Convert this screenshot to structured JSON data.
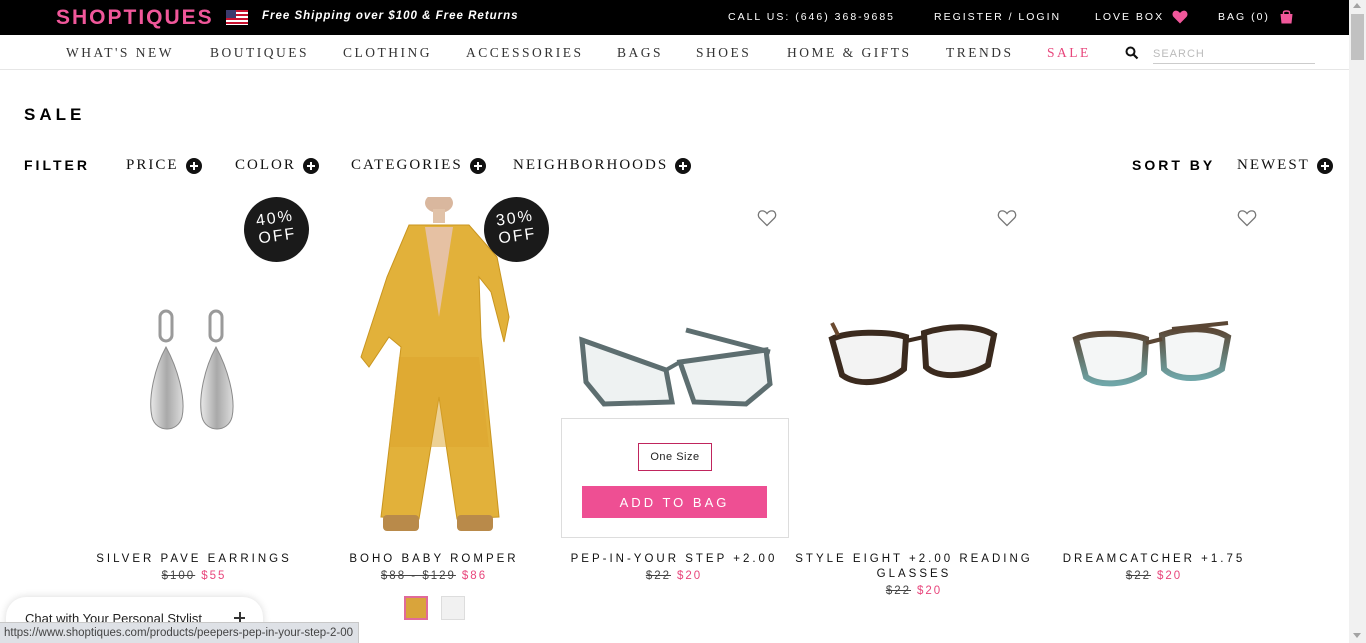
{
  "topbar": {
    "logo": "SHOPTIQUES",
    "shipping": "Free Shipping over $100 & Free Returns",
    "call": "CALL US: (646) 368-9685",
    "register": "REGISTER / LOGIN",
    "lovebox": "LOVE BOX",
    "bag": "BAG (0)",
    "accent": "#f0579a"
  },
  "nav": {
    "items": [
      "WHAT'S NEW",
      "BOUTIQUES",
      "CLOTHING",
      "ACCESSORIES",
      "BAGS",
      "SHOES",
      "HOME & GIFTS",
      "TRENDS",
      "SALE"
    ],
    "search_placeholder": "SEARCH"
  },
  "page_title": "SALE",
  "filters": {
    "label": "FILTER",
    "price": "PRICE",
    "color": "COLOR",
    "categories": "CATEGORIES",
    "neighborhoods": "NEIGHBORHOODS",
    "sort_label": "SORT BY",
    "sort_value": "NEWEST"
  },
  "products": [
    {
      "name": "SILVER PAVE EARRINGS",
      "old_price": "$100",
      "new_price": "$55",
      "badge": [
        "40%",
        "OFF"
      ]
    },
    {
      "name": "BOHO BABY ROMPER",
      "old_price": "$88 - $129",
      "new_price": "$86",
      "badge": [
        "30%",
        "OFF"
      ]
    },
    {
      "name": "PEP-IN-YOUR STEP +2.00",
      "old_price": "$22",
      "new_price": "$20",
      "size": "One Size",
      "add_to_bag": "ADD TO BAG"
    },
    {
      "name": "STYLE EIGHT +2.00 READING GLASSES",
      "old_price": "$22",
      "new_price": "$20"
    },
    {
      "name": "DREAMCATCHER +1.75",
      "old_price": "$22",
      "new_price": "$20"
    }
  ],
  "chat": "Chat with Your Personal Stylist",
  "status_url": "https://www.shoptiques.com/products/peepers-pep-in-your-step-2-00",
  "icons": [
    "us-flag-icon",
    "heart-icon",
    "shopping-bag-icon",
    "search-icon",
    "plus-circle-icon",
    "wishlist-heart-icon"
  ]
}
